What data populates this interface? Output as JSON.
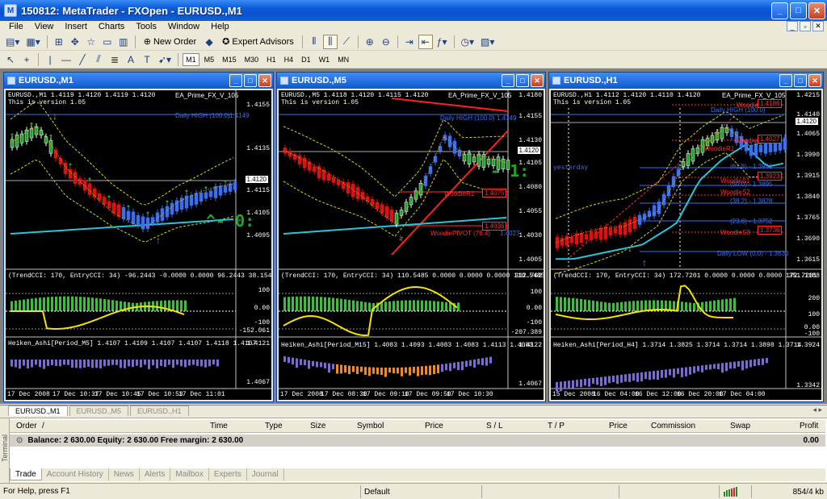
{
  "window": {
    "title": "150812: MetaTrader - FXOpen - EURUSD.,M1"
  },
  "menu": [
    "File",
    "View",
    "Insert",
    "Charts",
    "Tools",
    "Window",
    "Help"
  ],
  "toolbar": {
    "new_order": "New Order",
    "expert_advisors": "Expert Advisors"
  },
  "timeframes": [
    "M1",
    "M5",
    "M15",
    "M30",
    "H1",
    "H4",
    "D1",
    "W1",
    "MN"
  ],
  "colors": {
    "bull": "#1fa32a",
    "bear": "#e01010",
    "blue_candle": "#3b6ef0",
    "cyan_ma": "#26c6da",
    "yellow": "#f5e400",
    "hist_green": "#3cbf3c",
    "heiken_purple": "#7b6ad6",
    "heiken_orange": "#f08a1c",
    "titlebar": "#0a5ad6"
  },
  "charts": [
    {
      "title": "EURUSD.,M1",
      "info": "EURUSD.,M1  1.4119 1.4120 1.4119 1.4120",
      "version": "This is version 1.05",
      "ea": "EA_Prime_FX_V_105",
      "daily_high": "Daily HIGH (100.0)",
      "daily_high_price": "1.4149",
      "price_ticks": [
        "1.4155",
        "1.4135",
        "1.4120",
        "1.4115",
        "1.4105",
        "1.4095"
      ],
      "current_price": "1.4120",
      "big_label": "^- 0:",
      "cci": "(TrendCCI: 170, EntryCCI: 34)  -96.2443 -0.0000 0.0000 96.2443 38.1542 0.0000",
      "cci_ticks": [
        "236.905",
        "100",
        "0.00",
        "-100",
        "-152.061"
      ],
      "heiken": "Heiken_Ashi[Period_M5]  1.4107 1.4109 1.4107 1.4107 1.4118 1.4107",
      "heiken_ticks": [
        "1.4121",
        "1.4067"
      ],
      "time_ticks": [
        "17 Dec 2008",
        "17 Dec 10:37",
        "17 Dec 10:45",
        "17 Dec 10:53",
        "17 Dec 11:01"
      ],
      "red_labels": [],
      "red_boxes": []
    },
    {
      "title": "EURUSD.,M5",
      "info": "EURUSD.,M5  1.4118 1.4120 1.4115 1.4120",
      "version": "This is version 1.05",
      "ea": "EA_Prime_FX_V_105",
      "daily_high": "Daily HIGH (100.0)",
      "daily_high_price": "1.4149",
      "price_ticks": [
        "1.4180",
        "1.4155",
        "1.4130",
        "1.4120",
        "1.4105",
        "1.4080",
        "1.4055",
        "1.4030",
        "1.4005"
      ],
      "current_price": "1.4120",
      "big_label": "- 1:",
      "cci": "(TrendCCI: 170, EntryCCI: 34)  110.5485 0.0000 0.0000 0.0000 110.5485 94.1567 0.0000",
      "cci_ticks": [
        "312.762",
        "100",
        "0.00",
        "-100",
        "-207.389"
      ],
      "heiken": "Heiken_Ashi[Period_M15]  1.4083 1.4093 1.4083 1.4083 1.4113 1.4083",
      "heiken_ticks": [
        "1.4122",
        "1.4067"
      ],
      "time_ticks": [
        "17 Dec 2008",
        "17 Dec 08:30",
        "17 Dec 09:10",
        "17 Dec 09:50",
        "17 Dec 10:30"
      ],
      "red_labels": [
        {
          "text": "WoodieR1"
        },
        {
          "text": "WoodiePIVOT (76.4)"
        }
      ],
      "red_boxes": [
        {
          "text": "1.4075"
        },
        {
          "text": "1.4036"
        },
        {
          "text": "1.4027"
        }
      ]
    },
    {
      "title": "EURUSD.,H1",
      "info": "EURUSD.,H1  1.4112 1.4120 1.4110 1.4120",
      "version": "This is version 1.05",
      "ea": "EA_Prime_FX_V_105",
      "daily_high": "Daily HIGH (100.0)",
      "daily_high_price": "1.4149",
      "price_ticks": [
        "1.4215",
        "1.4140",
        "1.4120",
        "1.4065",
        "1.3990",
        "1.3915",
        "1.3840",
        "1.3765",
        "1.3690",
        "1.3615"
      ],
      "current_price": "1.4120",
      "big_label": "",
      "cci": "(TrendCCI: 170, EntryCCI: 34)  172.7201 0.0000 0.0000 0.0000 172.7201 94.3051 0.0000",
      "cci_ticks": [
        "351.1188",
        "200",
        "100",
        "0.00",
        "-100"
      ],
      "heiken": "Heiken_Ashi[Period_H4]  1.3714 1.3825 1.3714 1.3714 1.3898 1.3714",
      "heiken_ticks": [
        "1.3924",
        "1.3342"
      ],
      "time_ticks": [
        "15 Dec 2008",
        "16 Dec 04:00",
        "16 Dec 12:00",
        "16 Dec 20:00",
        "17 Dec 04:00"
      ],
      "red_labels": [
        {
          "text": "WoodieR2"
        },
        {
          "text": "WoodieR1"
        },
        {
          "text": "WoodieR1"
        },
        {
          "text": "WoodieS1"
        },
        {
          "text": "WoodieS2"
        },
        {
          "text": "WoodieS3"
        }
      ],
      "red_boxes": [
        {
          "text": "1.4186"
        },
        {
          "text": "1.4027"
        },
        {
          "text": "1.3923"
        },
        {
          "text": "1.3868"
        },
        {
          "text": "1.3736"
        }
      ],
      "fib_labels": [
        "(61.8) - 1.3951",
        "(50.0) - 1.3895",
        "(38.2) - 1.3828",
        "(23.6) - 1.3752"
      ],
      "yesterday": "yesterday",
      "daily_low": "Daily LOW (0.0) - 1.3630"
    }
  ],
  "chart_tabs": [
    "EURUSD.,M1",
    "EURUSD.,M5",
    "EURUSD.,H1"
  ],
  "terminal": {
    "side_label": "Terminal",
    "columns": [
      "Order",
      "/",
      "Time",
      "Type",
      "Size",
      "Symbol",
      "Price",
      "S / L",
      "T / P",
      "Price",
      "Commission",
      "Swap",
      "Profit"
    ],
    "balance": "Balance: 2 630.00  Equity: 2 630.00  Free margin: 2 630.00",
    "profit": "0.00",
    "tabs": [
      "Trade",
      "Account History",
      "News",
      "Alerts",
      "Mailbox",
      "Experts",
      "Journal"
    ]
  },
  "status": {
    "help": "For Help, press F1",
    "profile": "Default",
    "traffic": "854/4 kb"
  }
}
